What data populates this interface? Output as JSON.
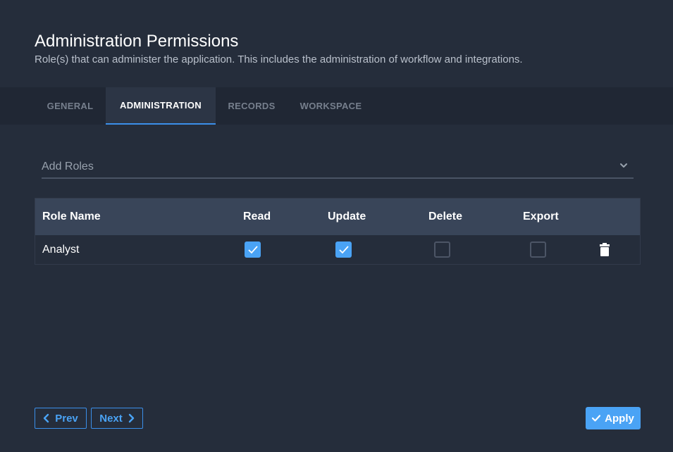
{
  "header": {
    "title": "Administration Permissions",
    "subtitle": "Role(s) that can administer the application. This includes the administration of workflow and integrations."
  },
  "tabs": [
    {
      "label": "GENERAL",
      "active": false
    },
    {
      "label": "ADMINISTRATION",
      "active": true
    },
    {
      "label": "RECORDS",
      "active": false
    },
    {
      "label": "WORKSPACE",
      "active": false
    }
  ],
  "add_roles": {
    "placeholder": "Add Roles",
    "icon": "chevron-down-icon"
  },
  "table": {
    "columns": [
      "Role Name",
      "Read",
      "Update",
      "Delete",
      "Export"
    ],
    "rows": [
      {
        "role": "Analyst",
        "read": true,
        "update": true,
        "delete": false,
        "export": false,
        "action_icon": "trash-icon"
      }
    ]
  },
  "footer": {
    "prev_label": "Prev",
    "next_label": "Next",
    "apply_label": "Apply"
  },
  "colors": {
    "background": "#252d3b",
    "accent": "#4aa3f5",
    "header_row": "#394559"
  }
}
